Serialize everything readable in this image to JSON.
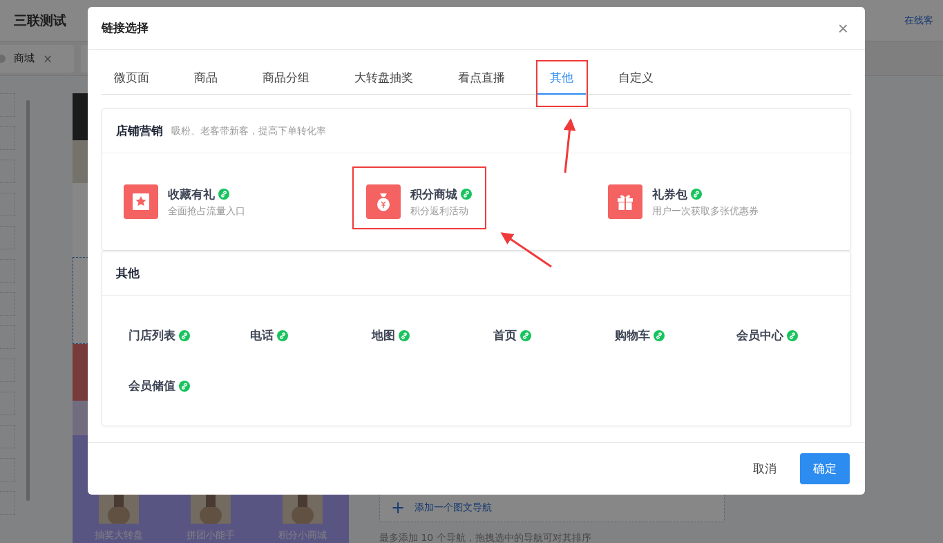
{
  "app": {
    "title": "三联测试",
    "support_link": "在线客",
    "tabs": [
      {
        "label": "商城",
        "close": "×"
      }
    ],
    "preview": {
      "nav_items": [
        {
          "label": "抽奖大转盘"
        },
        {
          "label": "拼团小能手"
        },
        {
          "label": "积分小商城"
        }
      ]
    },
    "add_nav": {
      "icon": "+",
      "label": "添加一个图文导航"
    },
    "hint": "最多添加 10 个导航，拖拽选中的导航可对其排序"
  },
  "dialog": {
    "title": "链接选择",
    "close": "×",
    "tabs": [
      {
        "label": "微页面",
        "selected": false
      },
      {
        "label": "商品",
        "selected": false
      },
      {
        "label": "商品分组",
        "selected": false
      },
      {
        "label": "大转盘抽奖",
        "selected": false
      },
      {
        "label": "看点直播",
        "selected": false
      },
      {
        "label": "其他",
        "selected": true
      },
      {
        "label": "自定义",
        "selected": false
      }
    ],
    "sections": [
      {
        "kind": "featured",
        "title": "店铺营销",
        "subtitle": "吸粉、老客带新客，提高下单转化率",
        "items": [
          {
            "name": "收藏有礼",
            "description": "全面抢占流量入口",
            "highlighted": false
          },
          {
            "name": "积分商城",
            "description": "积分返利活动",
            "highlighted": true
          },
          {
            "name": "礼券包",
            "description": "用户一次获取多张优惠券",
            "highlighted": false
          }
        ]
      },
      {
        "kind": "simple",
        "title": "其他",
        "items": [
          {
            "name": "门店列表"
          },
          {
            "name": "电话"
          },
          {
            "name": "地图"
          },
          {
            "name": "首页"
          },
          {
            "name": "购物车"
          },
          {
            "name": "会员中心"
          },
          {
            "name": "会员储值"
          }
        ]
      }
    ],
    "buttons": [
      {
        "label": "取消",
        "kind": "secondary"
      },
      {
        "label": "确定",
        "kind": "primary"
      }
    ]
  }
}
